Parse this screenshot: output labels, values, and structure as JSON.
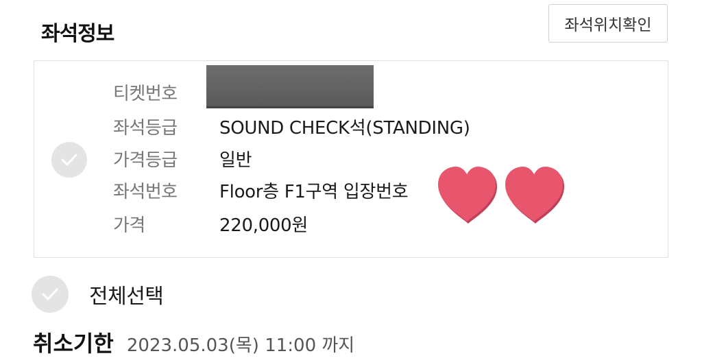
{
  "seat_info": {
    "title": "좌석정보",
    "location_button": "좌석위치확인",
    "rows": [
      {
        "label": "티켓번호",
        "value": ""
      },
      {
        "label": "좌석등급",
        "value": "SOUND CHECK석(STANDING)"
      },
      {
        "label": "가격등급",
        "value": "일반"
      },
      {
        "label": "좌석번호",
        "value": "Floor층 F1구역 입장번호"
      },
      {
        "label": "가격",
        "value": "220,000원"
      }
    ]
  },
  "select_all": {
    "label": "전체선택"
  },
  "cancel_deadline": {
    "label": "취소기한",
    "value": "2023.05.03(목) 11:00 까지"
  },
  "colors": {
    "check_circle": "#e4e4e4",
    "heart": "#e8566e",
    "redaction": "#606060"
  },
  "icons": {
    "check": "check-icon",
    "heart": "heart-icon"
  }
}
